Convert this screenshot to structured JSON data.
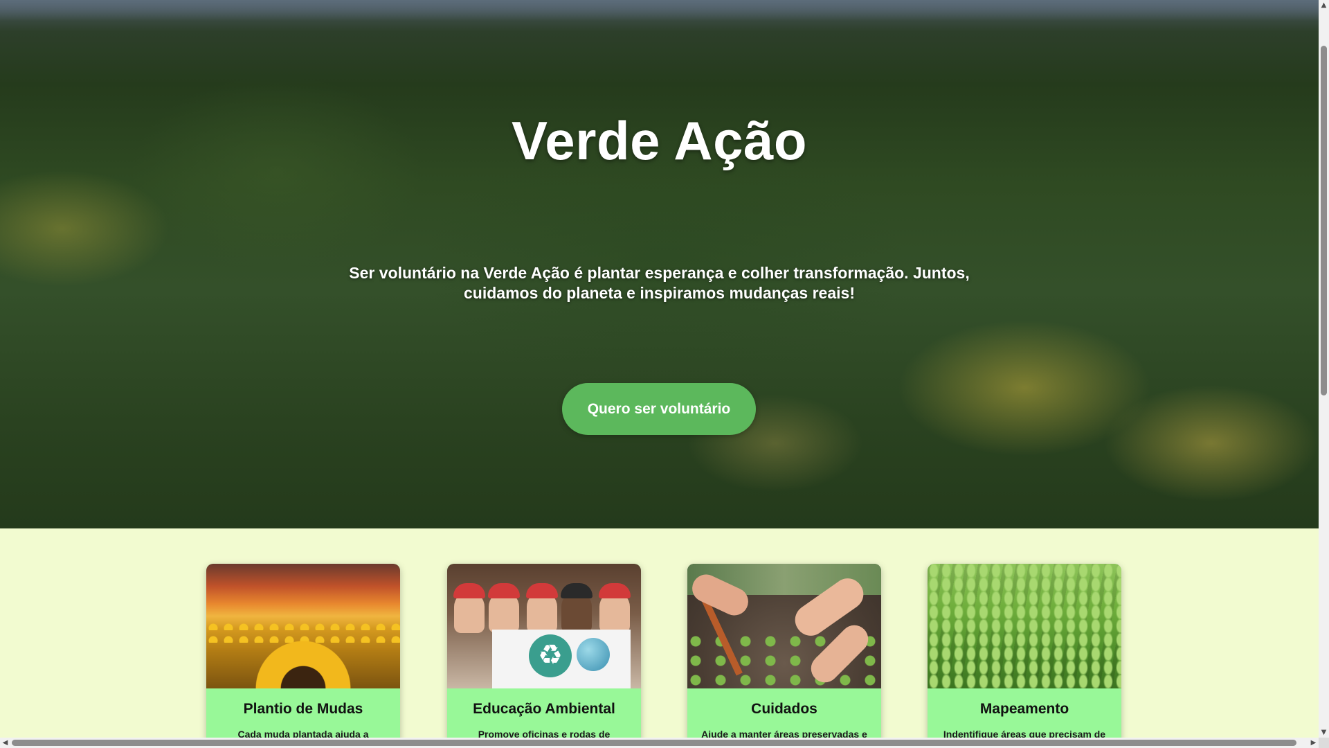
{
  "hero": {
    "title": "Verde Ação",
    "subtitle": "Ser voluntário na Verde Ação é plantar esperança e colher transformação. Juntos, cuidamos do planeta e inspiramos mudanças reais!",
    "cta_label": "Quero ser voluntário",
    "background": "forest-canopy-photo"
  },
  "cards": [
    {
      "title": "Plantio de Mudas",
      "text": "Cada muda plantada ajuda a",
      "image": "sunflower-field-photo"
    },
    {
      "title": "Educação Ambiental",
      "text": "Promove oficinas e rodas de",
      "image": "children-recycling-sign-photo"
    },
    {
      "title": "Cuidados",
      "text": "Ajude a manter áreas preservadas e",
      "image": "hands-gardening-photo"
    },
    {
      "title": "Mapeamento",
      "text": "Indentifique áreas que precisam de",
      "image": "tree-plantation-photo"
    }
  ],
  "scrollbars": {
    "up_arrow": "▲",
    "down_arrow": "▼",
    "left_arrow": "◀",
    "right_arrow": "▶"
  },
  "colors": {
    "cta": "#5cb85c",
    "card_body": "#98f898",
    "section_background": "#f2fbd0"
  }
}
